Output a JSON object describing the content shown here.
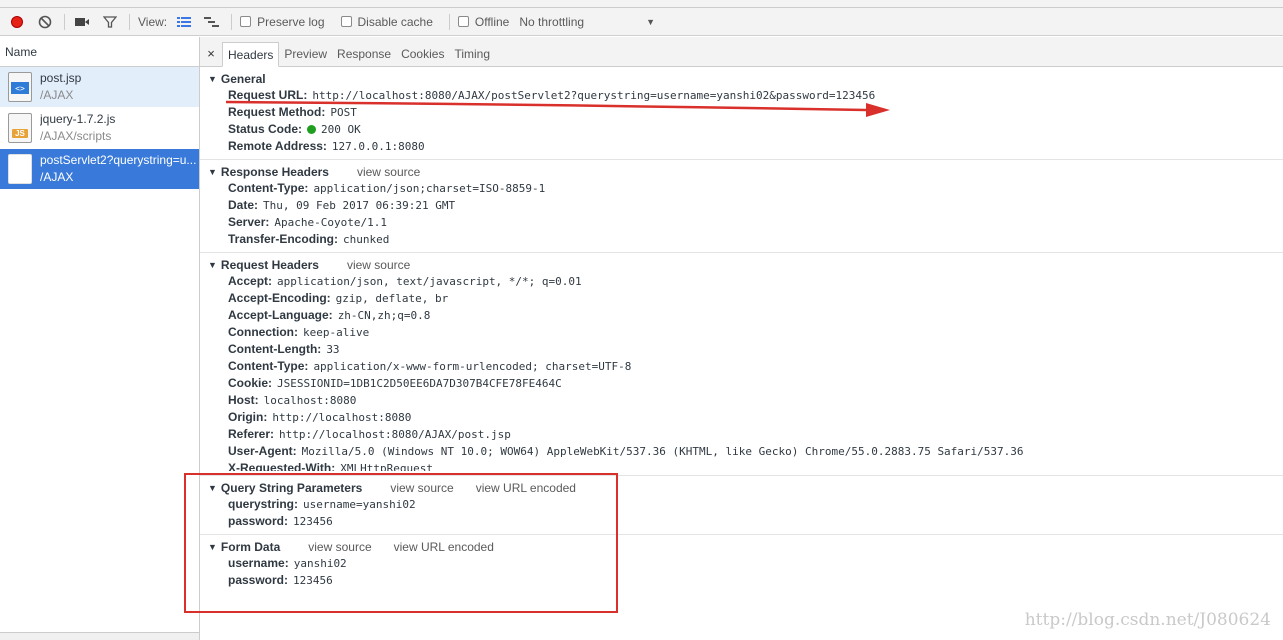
{
  "toolbar": {
    "view_label": "View:",
    "preserve_log": "Preserve log",
    "disable_cache": "Disable cache",
    "offline": "Offline",
    "throttling": "No throttling"
  },
  "left_pane": {
    "header": "Name",
    "requests": [
      {
        "name": "post.jsp",
        "path": "/AJAX",
        "icon": "html-file-icon"
      },
      {
        "name": "jquery-1.7.2.js",
        "path": "/AJAX/scripts",
        "icon": "js-file-icon",
        "icon_text": "JS"
      },
      {
        "name": "postServlet2?querystring=u...",
        "path": "/AJAX",
        "icon": "blank-file-icon"
      }
    ]
  },
  "tabs": [
    "Headers",
    "Preview",
    "Response",
    "Cookies",
    "Timing"
  ],
  "general": {
    "title": "General",
    "rows": [
      {
        "k": "Request URL:",
        "v": "http://localhost:8080/AJAX/postServlet2?querystring=username=yanshi02&password=123456"
      },
      {
        "k": "Request Method:",
        "v": "POST"
      },
      {
        "k": "Status Code:",
        "v": "200 OK"
      },
      {
        "k": "Remote Address:",
        "v": "127.0.0.1:8080"
      }
    ]
  },
  "response_headers": {
    "title": "Response Headers",
    "view_source": "view source",
    "rows": [
      {
        "k": "Content-Type:",
        "v": "application/json;charset=ISO-8859-1"
      },
      {
        "k": "Date:",
        "v": "Thu, 09 Feb 2017 06:39:21 GMT"
      },
      {
        "k": "Server:",
        "v": "Apache-Coyote/1.1"
      },
      {
        "k": "Transfer-Encoding:",
        "v": "chunked"
      }
    ]
  },
  "request_headers": {
    "title": "Request Headers",
    "view_source": "view source",
    "rows": [
      {
        "k": "Accept:",
        "v": "application/json, text/javascript, */*; q=0.01"
      },
      {
        "k": "Accept-Encoding:",
        "v": "gzip, deflate, br"
      },
      {
        "k": "Accept-Language:",
        "v": "zh-CN,zh;q=0.8"
      },
      {
        "k": "Connection:",
        "v": "keep-alive"
      },
      {
        "k": "Content-Length:",
        "v": "33"
      },
      {
        "k": "Content-Type:",
        "v": "application/x-www-form-urlencoded; charset=UTF-8"
      },
      {
        "k": "Cookie:",
        "v": "JSESSIONID=1DB1C2D50EE6DA7D307B4CFE78FE464C"
      },
      {
        "k": "Host:",
        "v": "localhost:8080"
      },
      {
        "k": "Origin:",
        "v": "http://localhost:8080"
      },
      {
        "k": "Referer:",
        "v": "http://localhost:8080/AJAX/post.jsp"
      },
      {
        "k": "User-Agent:",
        "v": "Mozilla/5.0 (Windows NT 10.0; WOW64) AppleWebKit/537.36 (KHTML, like Gecko) Chrome/55.0.2883.75 Safari/537.36"
      },
      {
        "k": "X-Requested-With:",
        "v": "XMLHttpRequest"
      }
    ]
  },
  "query_string": {
    "title": "Query String Parameters",
    "view_source": "view source",
    "view_url_encoded": "view URL encoded",
    "rows": [
      {
        "k": "querystring:",
        "v": "username=yanshi02"
      },
      {
        "k": "password:",
        "v": "123456"
      }
    ]
  },
  "form_data": {
    "title": "Form Data",
    "view_source": "view source",
    "view_url_encoded": "view URL encoded",
    "rows": [
      {
        "k": "username:",
        "v": "yanshi02"
      },
      {
        "k": "password:",
        "v": "123456"
      }
    ]
  },
  "watermark": "http://blog.csdn.net/J080624",
  "colors": {
    "annotation_red": "#d9302c",
    "selected_row": "#3879d9",
    "record": "#e62117",
    "status_green": "#1f9e1f"
  }
}
